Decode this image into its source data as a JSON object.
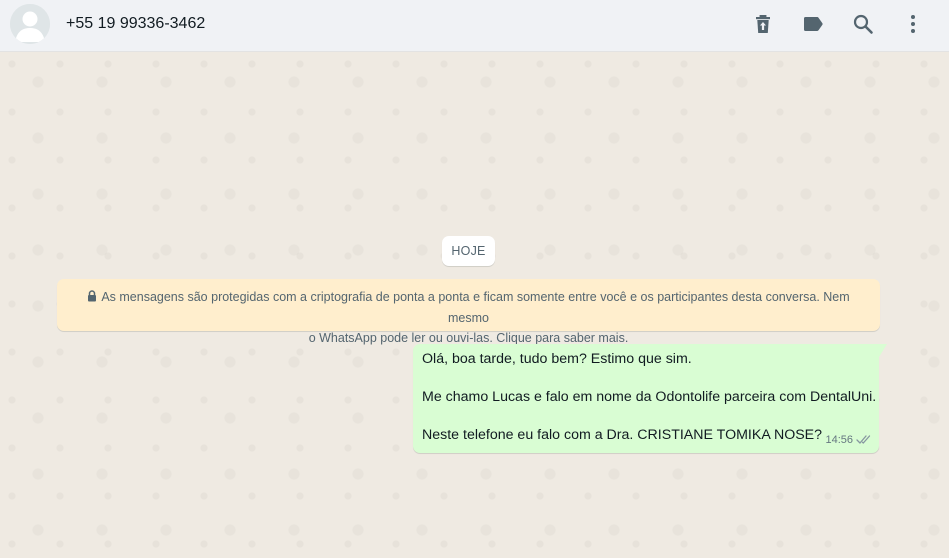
{
  "header": {
    "contact_name": "+55 19 99336-3462",
    "icons": [
      "delete-icon",
      "label-icon",
      "search-icon",
      "menu-icon"
    ]
  },
  "chat": {
    "date_chip": "HOJE",
    "encryption_line1": "As mensagens são protegidas com a criptografia de ponta a ponta e ficam somente entre você e os participantes desta conversa. Nem mesmo",
    "encryption_line2": "o WhatsApp pode ler ou ouvi-las. Clique para saber mais.",
    "messages": [
      {
        "direction": "outgoing",
        "lines": [
          "Olá, boa tarde, tudo bem? Estimo que sim.",
          "",
          "Me chamo Lucas e falo em nome da Odontolife parceira com DentalUni.",
          "",
          "Neste telefone eu falo com a Dra. CRISTIANE TOMIKA NOSE?"
        ],
        "time": "14:56",
        "status": "delivered"
      }
    ]
  },
  "colors": {
    "header_bg": "#f0f2f5",
    "chat_bg": "#efeae2",
    "outgoing_bubble": "#d9fdd3",
    "system_notice": "#ffeecd",
    "icon": "#54656f"
  }
}
